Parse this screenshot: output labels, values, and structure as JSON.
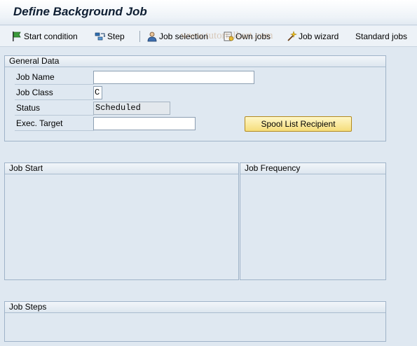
{
  "window": {
    "title": "Define Background Job"
  },
  "toolbar": {
    "start_condition": "Start condition",
    "step": "Step",
    "job_selection": "Job selection",
    "own_jobs": "Own jobs",
    "job_wizard": "Job wizard",
    "standard_jobs": "Standard jobs"
  },
  "watermark": "www.tutorialkart.com",
  "general_data": {
    "header": "General Data",
    "job_name_label": "Job Name",
    "job_name_value": "",
    "job_class_label": "Job Class",
    "job_class_value": "C",
    "status_label": "Status",
    "status_value": "Scheduled",
    "exec_target_label": "Exec. Target",
    "exec_target_value": "",
    "spool_button": "Spool List Recipient"
  },
  "job_start": {
    "header": "Job Start"
  },
  "job_frequency": {
    "header": "Job Frequency"
  },
  "job_steps": {
    "header": "Job Steps"
  },
  "colors": {
    "background": "#dfe8f1",
    "group_border": "#9fb3c8",
    "button_yellow": "#f5dd7a"
  }
}
